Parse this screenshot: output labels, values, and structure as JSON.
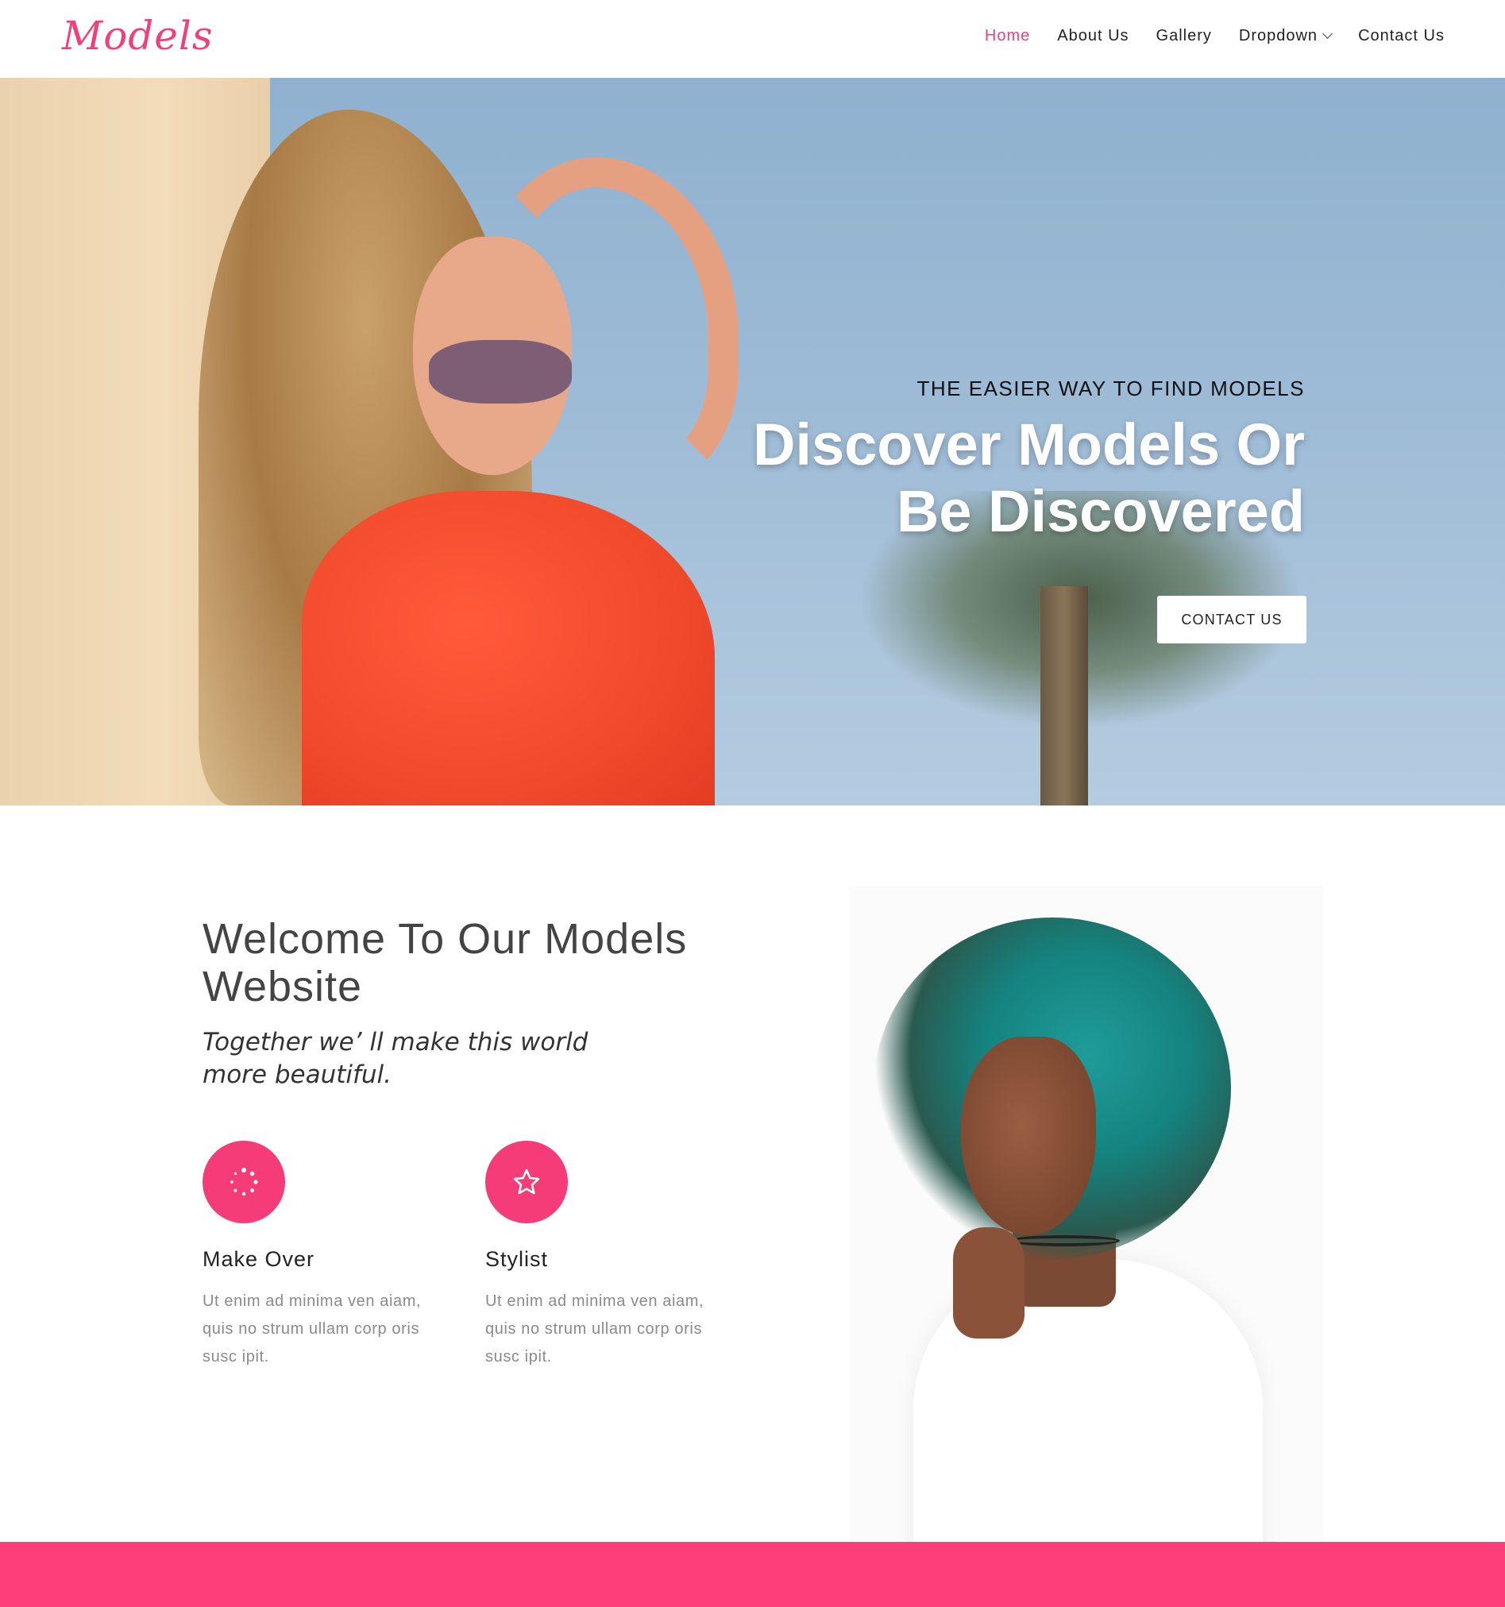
{
  "brand": {
    "logo_text": "Models",
    "accent": "#f0407a",
    "footer_color": "#fd3e7b"
  },
  "nav": {
    "items": [
      {
        "label": "Home",
        "active": true
      },
      {
        "label": "About Us"
      },
      {
        "label": "Gallery"
      },
      {
        "label": "Dropdown",
        "has_dropdown": true
      },
      {
        "label": "Contact Us"
      }
    ]
  },
  "hero": {
    "subtitle": "THE EASIER WAY TO FIND MODELS",
    "title_line1": "Discover Models Or",
    "title_line2": "Be Discovered",
    "button_label": "CONTACT US",
    "slides": 3
  },
  "welcome": {
    "title": "Welcome To Our Models Website",
    "tagline": "Together we’ ll make this world more beautiful."
  },
  "features": [
    {
      "icon": "spinner-icon",
      "title": "Make Over",
      "desc": "Ut enim ad minima ven aiam, quis no strum ullam corp oris susc ipit."
    },
    {
      "icon": "star-icon",
      "title": "Stylist",
      "desc": "Ut enim ad minima ven aiam, quis no strum ullam corp oris susc ipit."
    }
  ]
}
